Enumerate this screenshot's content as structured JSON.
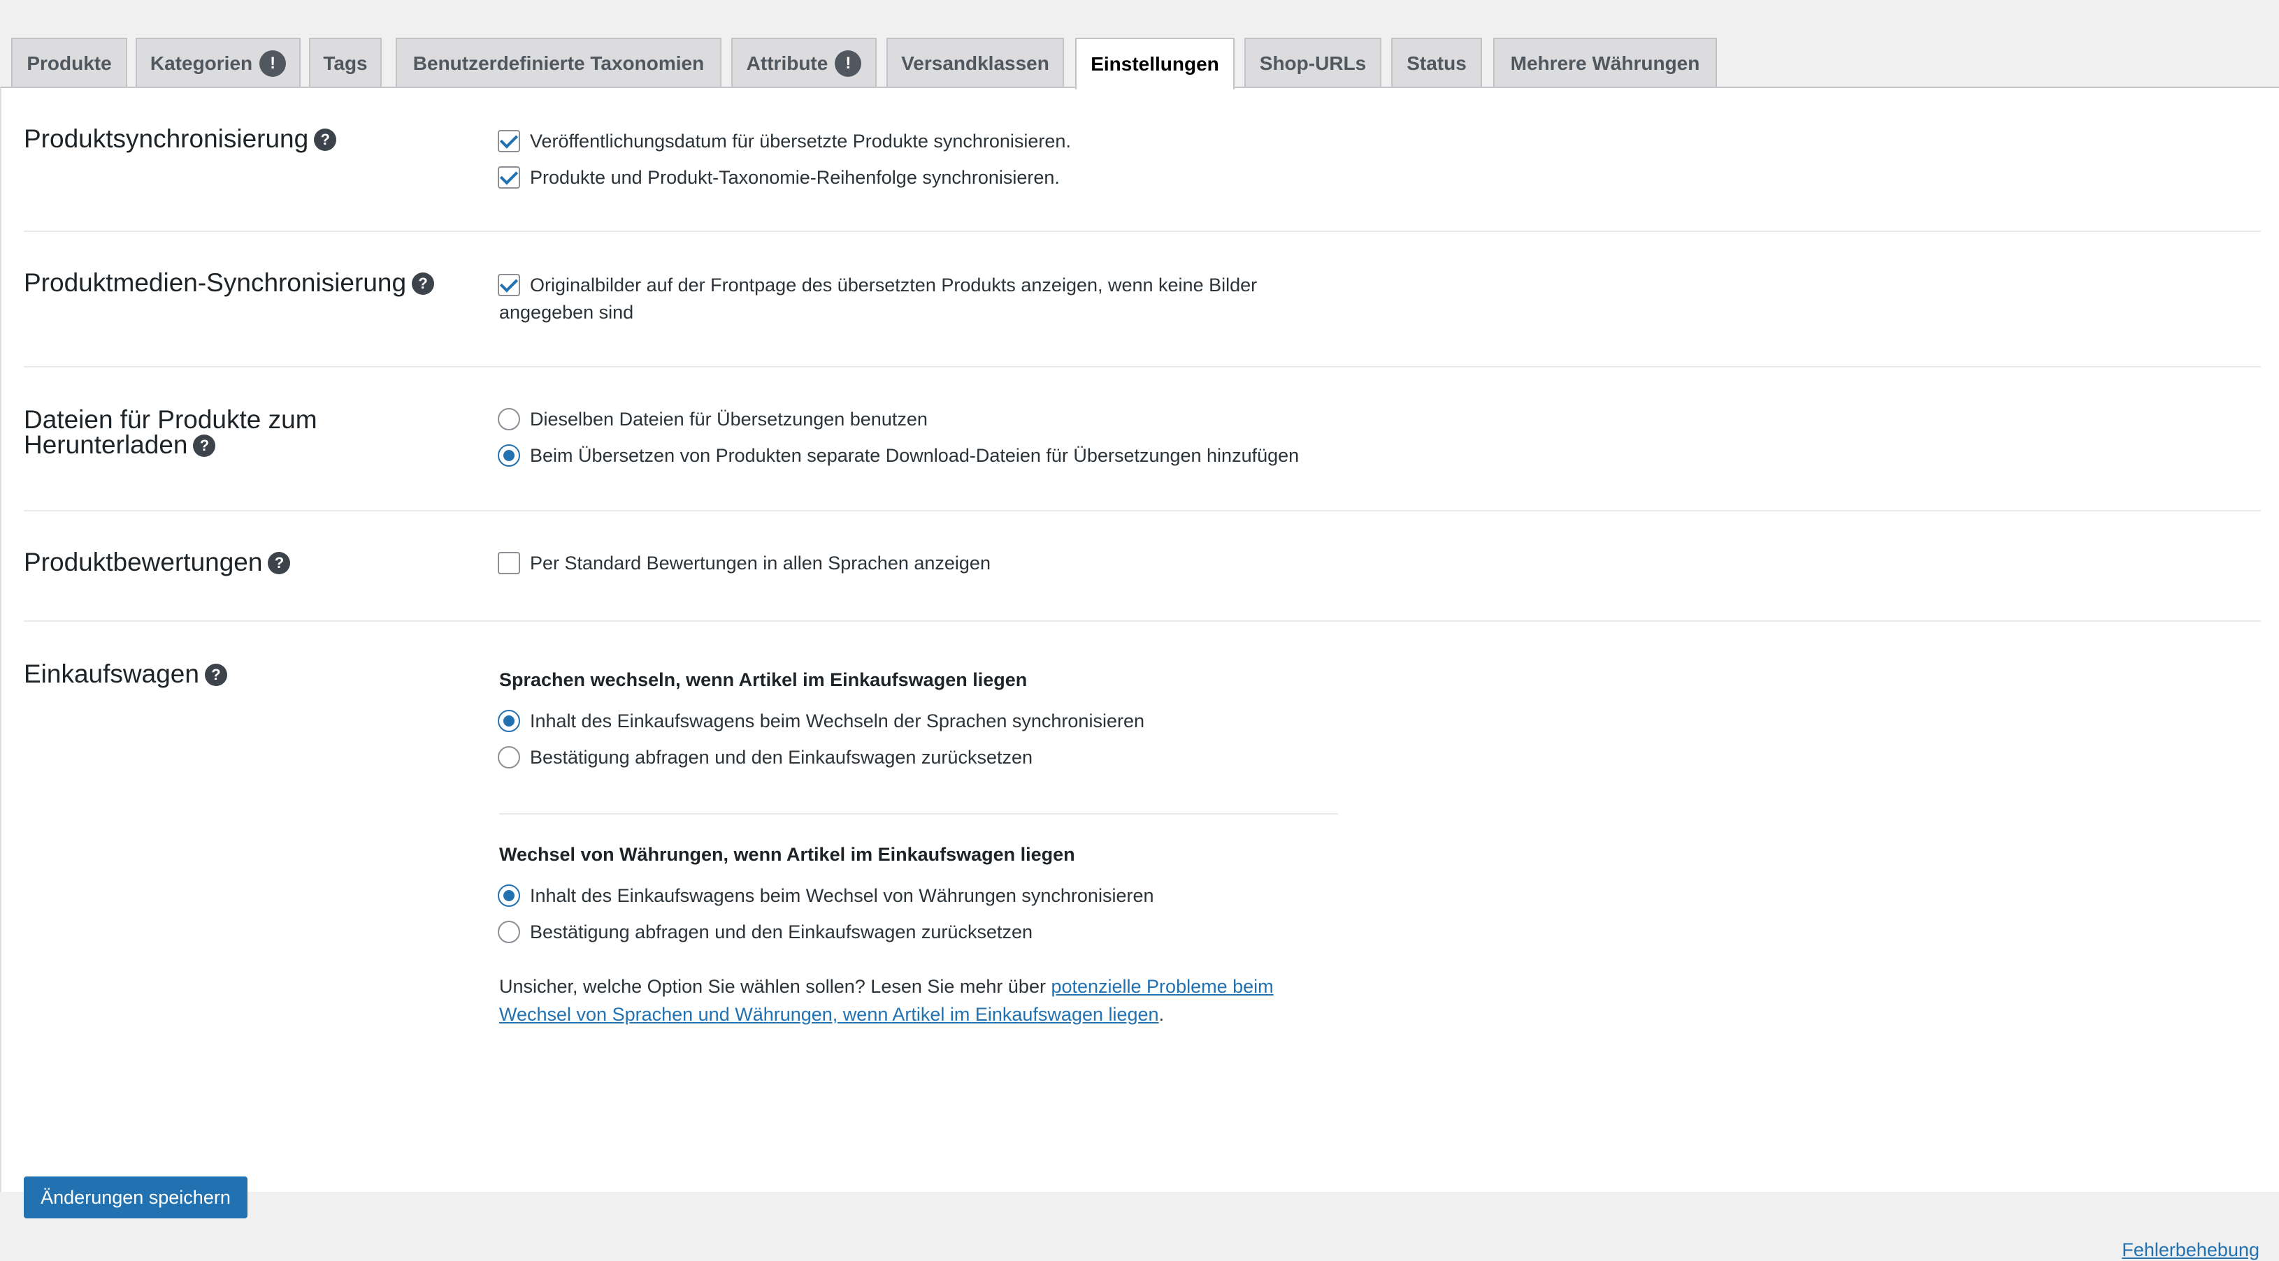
{
  "tabs": [
    {
      "label": "Produkte",
      "badge": ""
    },
    {
      "label": "Kategorien",
      "badge": "!"
    },
    {
      "label": "Tags",
      "badge": ""
    },
    {
      "label": "Benutzerdefinierte Taxonomien",
      "badge": ""
    },
    {
      "label": "Attribute",
      "badge": "!"
    },
    {
      "label": "Versandklassen",
      "badge": ""
    },
    {
      "label": "Einstellungen",
      "badge": ""
    },
    {
      "label": "Shop-URLs",
      "badge": ""
    },
    {
      "label": "Status",
      "badge": ""
    },
    {
      "label": "Mehrere Währungen",
      "badge": ""
    }
  ],
  "active_tab": "Einstellungen",
  "help_glyph": "?",
  "sections": {
    "product_sync": {
      "title": "Produktsynchronisierung",
      "options": [
        {
          "label": "Veröffentlichungsdatum für übersetzte Produkte synchronisieren.",
          "checked": true
        },
        {
          "label": "Produkte und Produkt-Taxonomie-Reihenfolge synchronisieren.",
          "checked": true
        }
      ]
    },
    "media_sync": {
      "title": "Produktmedien-Synchronisierung",
      "option_line1": "Originalbilder auf der Frontpage des übersetzten Produkts anzeigen, wenn keine Bilder",
      "option_line2": "angegeben sind",
      "checked": true
    },
    "downloads": {
      "title_line1": "Dateien für Produkte zum",
      "title_line2": "Herunterladen",
      "options": [
        {
          "label": "Dieselben Dateien für Übersetzungen benutzen",
          "selected": false
        },
        {
          "label": "Beim Übersetzen von Produkten separate Download-Dateien für Übersetzungen hinzufügen",
          "selected": true
        }
      ]
    },
    "reviews": {
      "title": "Produktbewertungen",
      "option": "Per Standard Bewertungen in allen Sprachen anzeigen",
      "checked": false
    },
    "cart": {
      "title": "Einkaufswagen",
      "lang_heading": "Sprachen wechseln, wenn Artikel im Einkaufswagen liegen",
      "lang_options": [
        {
          "label": "Inhalt des Einkaufswagens beim Wechseln der Sprachen synchronisieren",
          "selected": true
        },
        {
          "label": "Bestätigung abfragen und den Einkaufswagen zurücksetzen",
          "selected": false
        }
      ],
      "currency_heading": "Wechsel von Währungen, wenn Artikel im Einkaufswagen liegen",
      "currency_options": [
        {
          "label": "Inhalt des Einkaufswagens beim Wechsel von Währungen synchronisieren",
          "selected": true
        },
        {
          "label": "Bestätigung abfragen und den Einkaufswagen zurücksetzen",
          "selected": false
        }
      ],
      "note_prefix": "Unsicher, welche Option Sie wählen sollen? Lesen Sie mehr über ",
      "note_link": "potenzielle Probleme beim Wechsel von Sprachen und Währungen, wenn Artikel im Einkaufswagen liegen",
      "note_suffix": "."
    }
  },
  "save_button": "Änderungen speichern",
  "footer_link": "Fehlerbehebung",
  "colors": {
    "accent": "#2271b1",
    "panel": "#ffffff",
    "tab_bg": "#dcdcde"
  }
}
